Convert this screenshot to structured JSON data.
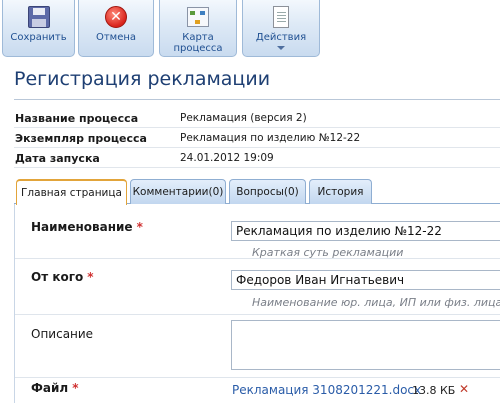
{
  "toolbar": {
    "save_label": "Сохранить",
    "cancel_label": "Отмена",
    "map_label_line1": "Карта",
    "map_label_line2": "процесса",
    "actions_label": "Действия"
  },
  "header": {
    "title": "Регистрация рекламации"
  },
  "info": [
    {
      "key": "Название процесса",
      "value": "Рекламация (версия 2)"
    },
    {
      "key": "Экземпляр процесса",
      "value": "Рекламация по изделию №12-22"
    },
    {
      "key": "Дата запуска",
      "value": "24.01.2012 19:09"
    }
  ],
  "tabs": [
    {
      "label": "Главная страница",
      "active": true
    },
    {
      "label": "Комментарии(0)",
      "active": false
    },
    {
      "label": "Вопросы(0)",
      "active": false
    },
    {
      "label": "История",
      "active": false
    }
  ],
  "form": {
    "name_label": "Наименование",
    "name_value": "Рекламация по изделию №12-22",
    "name_hint": "Краткая суть рекламации",
    "from_label": "От кого",
    "from_value": "Федоров Иван Игнатьевич",
    "from_hint": "Наименование юр. лица, ИП или физ. лица",
    "desc_label": "Описание",
    "file_label": "Файл",
    "file_name": "Рекламация 3108201221.docx",
    "file_size": "13.8 КБ",
    "required_mark": "*",
    "delete_mark": "✕"
  },
  "colors": {
    "accent": "#1e3f73",
    "link": "#2a5ca8",
    "required": "#d03030",
    "active_tab": "#e2a43a"
  }
}
